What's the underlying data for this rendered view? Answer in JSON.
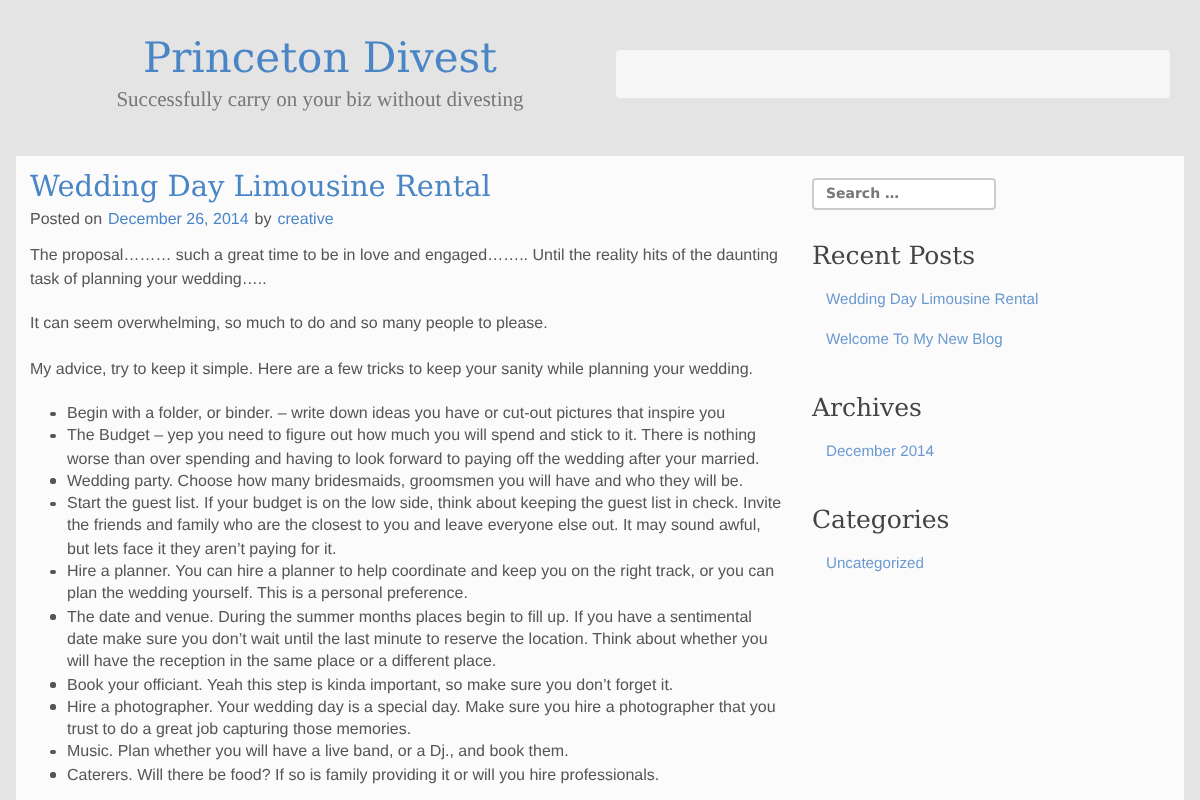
{
  "site": {
    "title": "Princeton Divest",
    "tagline": "Successfully carry on your biz without divesting"
  },
  "post": {
    "title": "Wedding Day Limousine Rental",
    "posted_on": "Posted on",
    "date": "December 26, 2014",
    "by": "by",
    "author": "creative",
    "paragraphs": [
      "The proposal……… such a great time to be in love and engaged…….. Until the reality hits of the daunting task of planning your wedding…..",
      "It can seem overwhelming, so much to do and so many people to please.",
      "My advice, try to keep it simple. Here are a few tricks to keep your sanity while planning your wedding."
    ],
    "list": [
      "Begin with a folder, or binder. – write down ideas you have or cut-out pictures that inspire you",
      "The Budget – yep you need to figure out how much you will spend and stick to it. There is nothing worse than over spending and having to look forward to paying off the wedding after your married.",
      "Wedding party. Choose how many bridesmaids, groomsmen you will have and who they will be.",
      "Start the guest list. If your budget is on the low side, think about keeping the guest list in check. Invite the friends and family who are the closest to you and leave everyone else out. It may sound awful, but lets face it they aren’t paying for it.",
      "Hire a planner. You can hire a planner to help coordinate and keep you on the right track, or you can plan the wedding yourself. This is a personal preference.",
      "The date and venue. During the summer months places begin to fill up. If you have a sentimental date make sure you don’t wait until the last minute to reserve the location. Think about whether you will have the reception in the same place or a different place.",
      "Book your officiant. Yeah this step is kinda important, so make sure you don’t forget it.",
      "Hire a photographer. Your wedding day is a special day. Make sure you hire a photographer that you trust to do a great job capturing those memories.",
      "Music. Plan whether you will have a live band, or a Dj., and book them.",
      "Caterers. Will there be food? If so is family providing it or will you hire professionals."
    ]
  },
  "sidebar": {
    "search": {
      "placeholder": "Search …"
    },
    "widgets": [
      {
        "title": "Recent Posts",
        "links": [
          "Wedding Day Limousine Rental",
          "Welcome To My New Blog"
        ]
      },
      {
        "title": "Archives",
        "links": [
          "December 2014"
        ]
      },
      {
        "title": "Categories",
        "links": [
          "Uncategorized"
        ]
      }
    ]
  }
}
